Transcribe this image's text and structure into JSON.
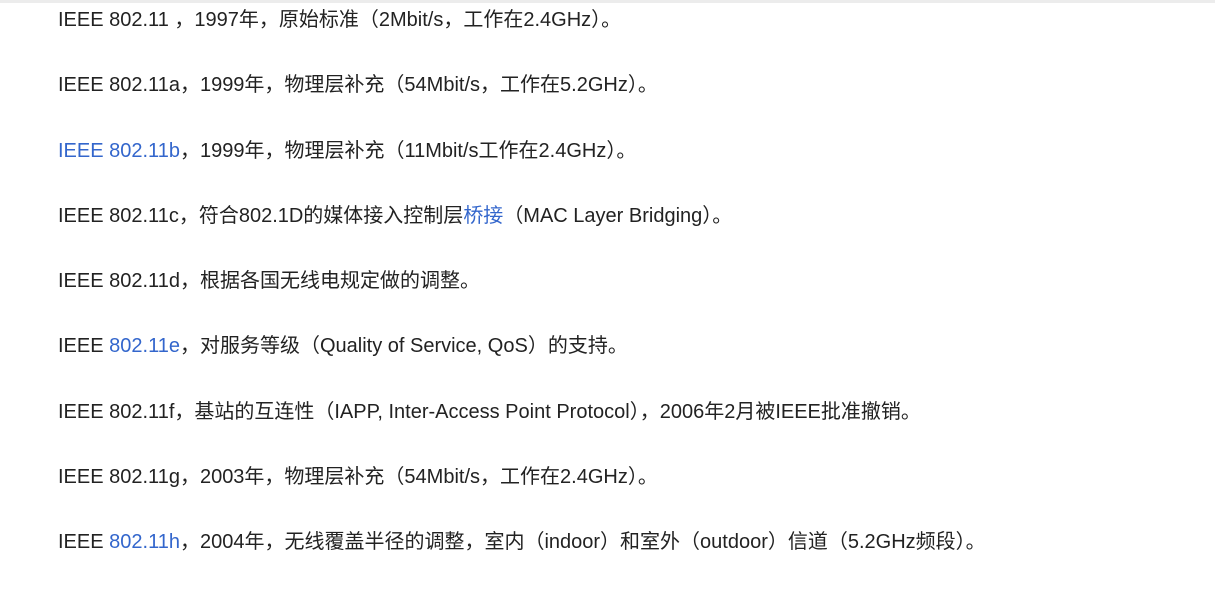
{
  "colors": {
    "text": "#222222",
    "link": "#3366cc"
  },
  "items": [
    {
      "parts": [
        {
          "text": "IEEE 802.11 ，1997年，原始标准（2Mbit/s，工作在2.4GHz）。",
          "link": false
        }
      ]
    },
    {
      "parts": [
        {
          "text": "IEEE 802.11a，1999年，物理层补充（54Mbit/s，工作在5.2GHz）。",
          "link": false
        }
      ]
    },
    {
      "parts": [
        {
          "text": "IEEE 802.11b",
          "link": true
        },
        {
          "text": "，1999年，物理层补充（11Mbit/s工作在2.4GHz）。",
          "link": false
        }
      ]
    },
    {
      "parts": [
        {
          "text": "IEEE 802.11c，符合802.1D的媒体接入控制层",
          "link": false
        },
        {
          "text": "桥接",
          "link": true
        },
        {
          "text": "（MAC Layer Bridging）。",
          "link": false
        }
      ]
    },
    {
      "parts": [
        {
          "text": "IEEE 802.11d，根据各国无线电规定做的调整。",
          "link": false
        }
      ]
    },
    {
      "parts": [
        {
          "text": "IEEE ",
          "link": false
        },
        {
          "text": "802.11e",
          "link": true
        },
        {
          "text": "，对服务等级（Quality of Service, QoS）的支持。",
          "link": false
        }
      ]
    },
    {
      "parts": [
        {
          "text": "IEEE 802.11f，基站的互连性（IAPP, Inter-Access Point Protocol），2006年2月被IEEE批准撤销。",
          "link": false
        }
      ]
    },
    {
      "parts": [
        {
          "text": "IEEE 802.11g，2003年，物理层补充（54Mbit/s，工作在2.4GHz）。",
          "link": false
        }
      ]
    },
    {
      "parts": [
        {
          "text": "IEEE ",
          "link": false
        },
        {
          "text": "802.11h",
          "link": true
        },
        {
          "text": "，2004年，无线覆盖半径的调整，室内（indoor）和室外（outdoor）信道（5.2GHz频段）。",
          "link": false
        }
      ]
    }
  ]
}
